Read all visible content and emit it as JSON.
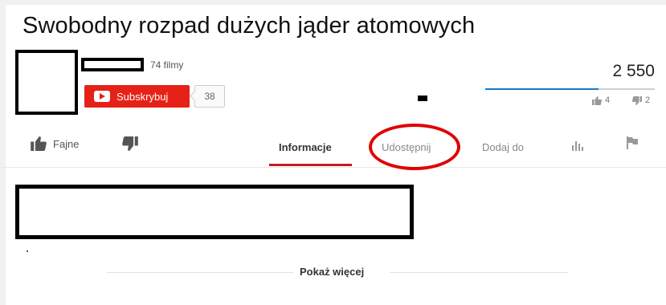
{
  "video": {
    "title": "Swobodny rozpad dużych jąder atomowych",
    "views": "2 550",
    "likes_ratio": 0.67
  },
  "channel": {
    "video_count": "74 filmy",
    "subscribe_label": "Subskrybuj",
    "subscriber_count": "38"
  },
  "stats": {
    "likes": "4",
    "dislikes": "2"
  },
  "actions": {
    "like_label": "Fajne"
  },
  "tabs": [
    {
      "label": "Informacje",
      "active": true
    },
    {
      "label": "Udostępnij",
      "active": false
    },
    {
      "label": "Dodaj do",
      "active": false
    }
  ],
  "description": {
    "show_more": "Pokaż więcej"
  },
  "icons": {
    "like": "thumbs-up-icon",
    "dislike": "thumbs-down-icon",
    "stats": "bar-chart-icon",
    "flag": "flag-icon",
    "subscribe": "youtube-play-icon"
  },
  "colors": {
    "subscribe_red": "#e62117",
    "accent_blue": "#167ac6",
    "tab_underline": "#cc181e",
    "annotation_circle": "#e00000"
  }
}
